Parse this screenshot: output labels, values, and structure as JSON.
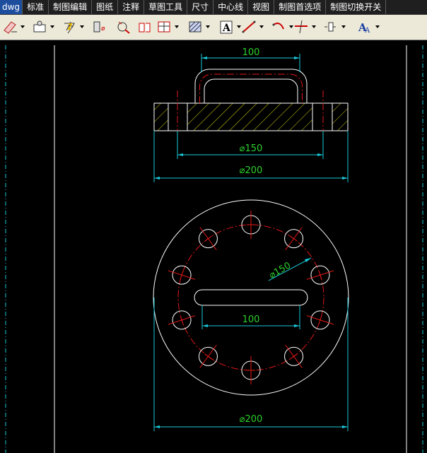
{
  "menubar": {
    "items": [
      "dwg",
      "标准",
      "制图编辑",
      "图纸",
      "注释",
      "草图工具",
      "尺寸",
      "中心线",
      "视图",
      "制图首选项",
      "制图切换开关"
    ]
  },
  "toolbar": {
    "tools": [
      {
        "icon": "eraser-pencil-icon",
        "has_dropdown": true
      },
      {
        "icon": "view-settings-icon",
        "has_dropdown": true
      },
      {
        "icon": "lightning-update-icon",
        "has_dropdown": true
      },
      {
        "icon": "section-icon",
        "has_dropdown": false
      },
      {
        "icon": "detail-view-icon",
        "has_dropdown": false
      },
      {
        "icon": "break-view-icon",
        "has_dropdown": false
      },
      {
        "icon": "broken-out-section-icon",
        "has_dropdown": true
      },
      {
        "icon": "hatch-icon",
        "has_dropdown": true
      },
      {
        "icon": "note-text-icon",
        "has_dropdown": true
      },
      {
        "icon": "line-icon",
        "has_dropdown": true
      },
      {
        "icon": "arc-icon",
        "has_dropdown": true
      },
      {
        "icon": "trim-icon",
        "has_dropdown": true
      },
      {
        "icon": "centerline-icon",
        "has_dropdown": true
      },
      {
        "icon": "text-style-icon",
        "has_dropdown": true
      }
    ]
  },
  "drawing": {
    "colors": {
      "geometry": "#ffffff",
      "dimension": "#18c8d8",
      "dim_text": "#2bd12b",
      "centerline": "#e01818",
      "hatch": "#d6d61a",
      "border": "#ffffff"
    },
    "front_view": {
      "handle_width_dim": "100",
      "bolt_circle_dim": "⌀150",
      "outer_diameter_dim": "⌀200"
    },
    "top_view": {
      "bolt_circle_dim": "⌀150",
      "slot_length_dim": "100",
      "outer_diameter_dim": "⌀200",
      "hole_count": 10
    }
  }
}
